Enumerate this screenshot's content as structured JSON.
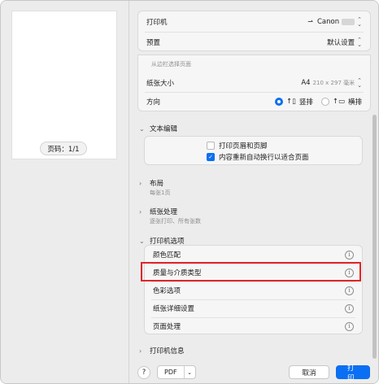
{
  "preview": {
    "page_indicator": "页码：1/1"
  },
  "header": {
    "printer_label": "打印机",
    "printer_value": "Canon",
    "preset_label": "预置",
    "preset_value": "默认设置"
  },
  "paper": {
    "hint": "从边栏选择页面",
    "size_label": "纸张大小",
    "size_value": "A4",
    "size_detail": "210 x 297 毫米",
    "orientation_label": "方向",
    "portrait_label": "竖排",
    "landscape_label": "横排"
  },
  "text_edit": {
    "title": "文本编辑",
    "option_header_footer": "打印页眉和页脚",
    "option_rewrap": "内容重新自动换行以适合页面"
  },
  "layout": {
    "title": "布局",
    "subtitle": "每张1页"
  },
  "paper_handling": {
    "title": "纸张处理",
    "subtitle": "逐张打印、所有张数"
  },
  "printer_options": {
    "title": "打印机选项",
    "items": [
      "颜色匹配",
      "质量与介质类型",
      "色彩选项",
      "纸张详细设置",
      "页面处理"
    ]
  },
  "printer_info": {
    "title": "打印机信息"
  },
  "footer": {
    "help": "?",
    "pdf": "PDF",
    "cancel": "取消",
    "print": "打印"
  },
  "colors": {
    "accent": "#0a6ff2",
    "highlight": "#e0252b"
  }
}
